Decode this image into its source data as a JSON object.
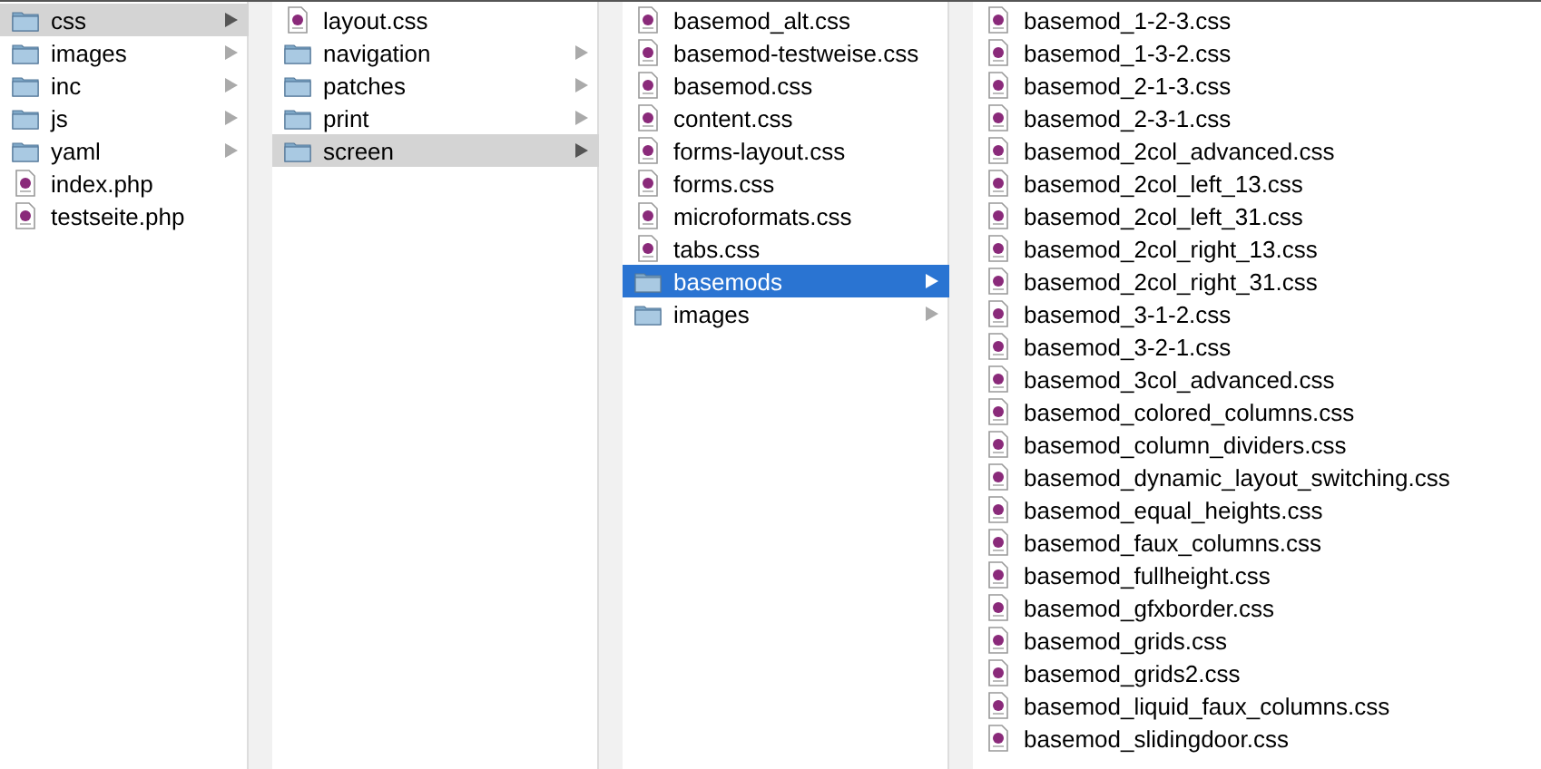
{
  "columns": [
    {
      "active": false,
      "items": [
        {
          "name": "css",
          "kind": "folder",
          "selected": true
        },
        {
          "name": "images",
          "kind": "folder",
          "selected": false
        },
        {
          "name": "inc",
          "kind": "folder",
          "selected": false
        },
        {
          "name": "js",
          "kind": "folder",
          "selected": false
        },
        {
          "name": "yaml",
          "kind": "folder",
          "selected": false
        },
        {
          "name": "index.php",
          "kind": "file",
          "selected": false
        },
        {
          "name": "testseite.php",
          "kind": "file",
          "selected": false
        }
      ]
    },
    {
      "active": false,
      "items": [
        {
          "name": "layout.css",
          "kind": "file",
          "selected": false
        },
        {
          "name": "navigation",
          "kind": "folder",
          "selected": false
        },
        {
          "name": "patches",
          "kind": "folder",
          "selected": false
        },
        {
          "name": "print",
          "kind": "folder",
          "selected": false
        },
        {
          "name": "screen",
          "kind": "folder",
          "selected": true
        }
      ]
    },
    {
      "active": true,
      "items": [
        {
          "name": "basemod_alt.css",
          "kind": "file",
          "selected": false
        },
        {
          "name": "basemod-testweise.css",
          "kind": "file",
          "selected": false
        },
        {
          "name": "basemod.css",
          "kind": "file",
          "selected": false
        },
        {
          "name": "content.css",
          "kind": "file",
          "selected": false
        },
        {
          "name": "forms-layout.css",
          "kind": "file",
          "selected": false
        },
        {
          "name": "forms.css",
          "kind": "file",
          "selected": false
        },
        {
          "name": "microformats.css",
          "kind": "file",
          "selected": false
        },
        {
          "name": "tabs.css",
          "kind": "file",
          "selected": false
        },
        {
          "name": "basemods",
          "kind": "folder",
          "selected": true
        },
        {
          "name": "images",
          "kind": "folder",
          "selected": false
        }
      ]
    },
    {
      "items": [
        {
          "name": "basemod_1-2-3.css",
          "kind": "file",
          "selected": false
        },
        {
          "name": "basemod_1-3-2.css",
          "kind": "file",
          "selected": false
        },
        {
          "name": "basemod_2-1-3.css",
          "kind": "file",
          "selected": false
        },
        {
          "name": "basemod_2-3-1.css",
          "kind": "file",
          "selected": false
        },
        {
          "name": "basemod_2col_advanced.css",
          "kind": "file",
          "selected": false
        },
        {
          "name": "basemod_2col_left_13.css",
          "kind": "file",
          "selected": false
        },
        {
          "name": "basemod_2col_left_31.css",
          "kind": "file",
          "selected": false
        },
        {
          "name": "basemod_2col_right_13.css",
          "kind": "file",
          "selected": false
        },
        {
          "name": "basemod_2col_right_31.css",
          "kind": "file",
          "selected": false
        },
        {
          "name": "basemod_3-1-2.css",
          "kind": "file",
          "selected": false
        },
        {
          "name": "basemod_3-2-1.css",
          "kind": "file",
          "selected": false
        },
        {
          "name": "basemod_3col_advanced.css",
          "kind": "file",
          "selected": false
        },
        {
          "name": "basemod_colored_columns.css",
          "kind": "file",
          "selected": false
        },
        {
          "name": "basemod_column_dividers.css",
          "kind": "file",
          "selected": false
        },
        {
          "name": "basemod_dynamic_layout_switching.css",
          "kind": "file",
          "selected": false
        },
        {
          "name": "basemod_equal_heights.css",
          "kind": "file",
          "selected": false
        },
        {
          "name": "basemod_faux_columns.css",
          "kind": "file",
          "selected": false
        },
        {
          "name": "basemod_fullheight.css",
          "kind": "file",
          "selected": false
        },
        {
          "name": "basemod_gfxborder.css",
          "kind": "file",
          "selected": false
        },
        {
          "name": "basemod_grids.css",
          "kind": "file",
          "selected": false
        },
        {
          "name": "basemod_grids2.css",
          "kind": "file",
          "selected": false
        },
        {
          "name": "basemod_liquid_faux_columns.css",
          "kind": "file",
          "selected": false
        },
        {
          "name": "basemod_slidingdoor.css",
          "kind": "file",
          "selected": false
        }
      ]
    }
  ]
}
